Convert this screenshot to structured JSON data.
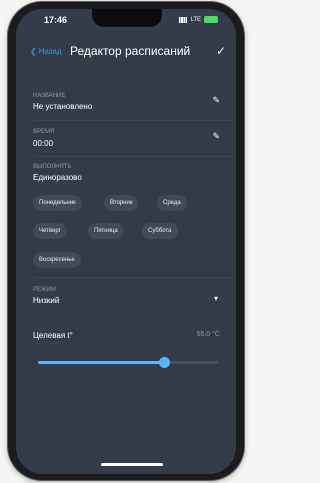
{
  "status_bar": {
    "time": "17:46",
    "network": "LTE"
  },
  "header": {
    "back_label": "Назад",
    "title": "Редактор расписаний"
  },
  "fields": {
    "name": {
      "label": "НАЗВАНИЕ",
      "value": "Не установлено"
    },
    "time": {
      "label": "ВРЕМЯ",
      "value": "00:00"
    },
    "execute": {
      "label": "ВЫПОЛНЯТЬ",
      "value": "Единоразово"
    },
    "mode": {
      "label": "РЕЖИМ",
      "value": "Низкий"
    }
  },
  "days": [
    "Понедельник",
    "Вторник",
    "Среда",
    "Четверг",
    "Пятница",
    "Суббота",
    "Воскресенье"
  ],
  "temperature": {
    "label": "Целевая t°",
    "value": "55.0 °C",
    "slider_fraction": 0.7
  },
  "colors": {
    "background": "#343c49",
    "accent": "#5cb4ff",
    "back_link": "#2d9cdb"
  },
  "icons": {
    "back": "chevron-left-icon",
    "confirm": "check-icon",
    "edit": "pencil-icon",
    "dropdown": "triangle-down-icon"
  }
}
